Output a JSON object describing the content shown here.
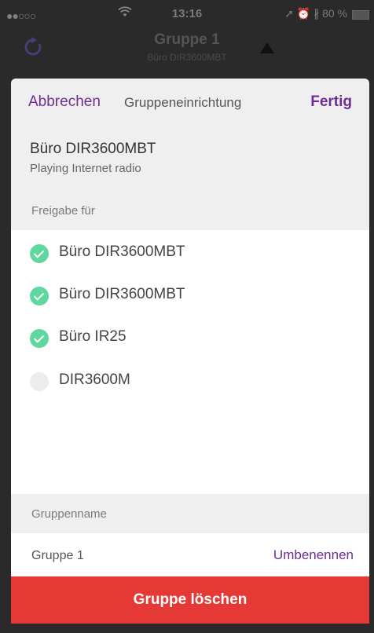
{
  "status_bar": {
    "signal": "●●○○○",
    "wifi_icon": "wifi-icon",
    "time": "13:16",
    "right": "➚ ⏰ ∦ 80 %"
  },
  "background": {
    "title": "Gruppe 1",
    "subtitle": "Büro DIR3600MBT"
  },
  "modal": {
    "cancel_label": "Abbrechen",
    "title": "Gruppeneinrichtung",
    "done_label": "Fertig",
    "device_name": "Büro DIR3600MBT",
    "device_status": "Playing Internet radio",
    "share_label": "Freigabe für",
    "devices": [
      {
        "name": "Büro DIR3600MBT",
        "checked": true
      },
      {
        "name": "Büro DIR3600MBT",
        "checked": true
      },
      {
        "name": "Büro IR25",
        "checked": true
      },
      {
        "name": "DIR3600M",
        "checked": false
      }
    ],
    "group_name_label": "Gruppenname",
    "group_name_value": "Gruppe 1",
    "rename_label": "Umbenennen",
    "delete_label": "Gruppe löschen"
  },
  "colors": {
    "accent": "#6f2d94",
    "check": "#5fd8a0",
    "danger": "#e53935"
  }
}
